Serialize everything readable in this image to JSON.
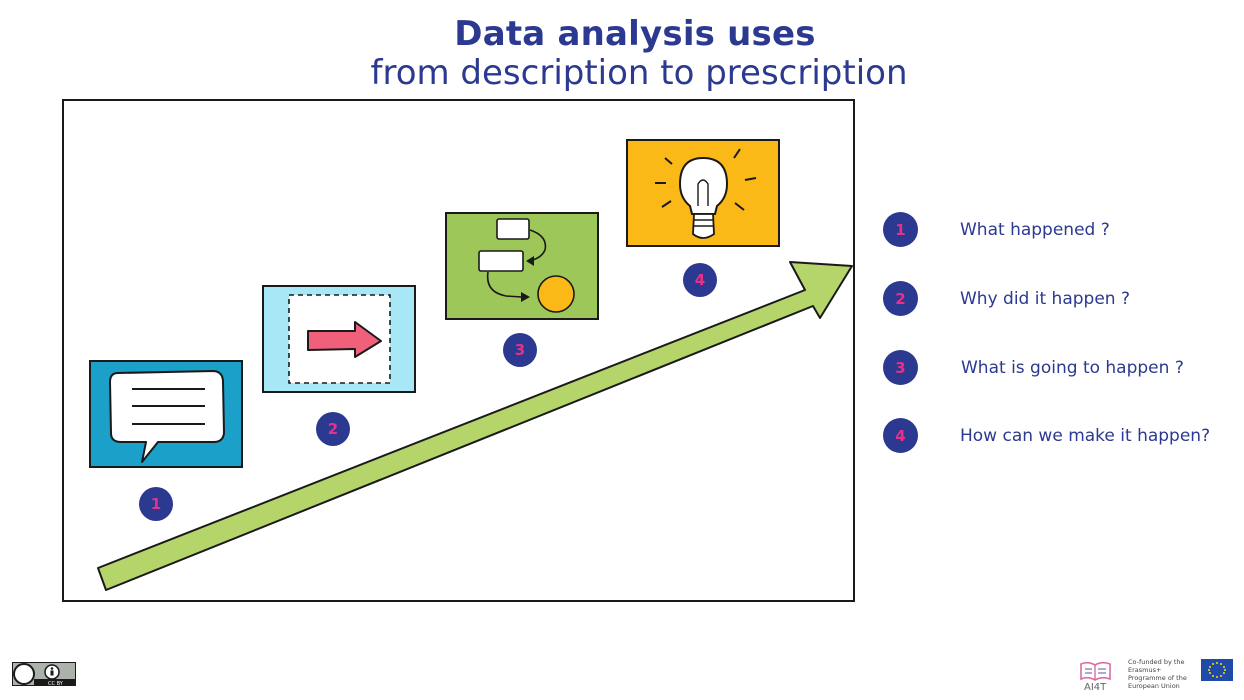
{
  "header": {
    "title": "Data analysis uses",
    "subtitle": "from description to prescription"
  },
  "steps": [
    {
      "number": "1",
      "label": "What happened ?"
    },
    {
      "number": "2",
      "label": "Why did it happen ?"
    },
    {
      "number": "3",
      "label": "What is going to happen ?"
    },
    {
      "number": "4",
      "label": "How can we make it happen?"
    }
  ],
  "footer": {
    "license": "CC BY",
    "ai4t_label": "AI4T",
    "eu_funding": "Co-funded by the Erasmus+ Programme of the European Union"
  },
  "colors": {
    "accent": "#2b3990",
    "badge_number": "#e8308a",
    "arrow_green": "#b5d56a",
    "step1_bg": "#1ba1c9",
    "step2_bg": "#a8e8f6",
    "step3_bg": "#9ec75a",
    "step4_bg": "#fbb917"
  }
}
